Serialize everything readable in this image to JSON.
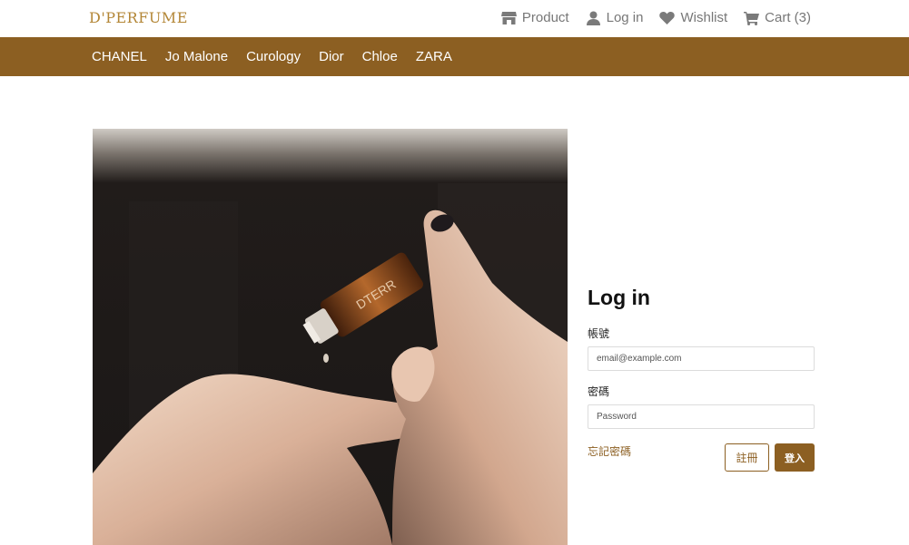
{
  "header": {
    "logo": "D'PERFUME",
    "links": [
      {
        "label": "Product",
        "icon": "store-icon"
      },
      {
        "label": "Log in",
        "icon": "user-icon"
      },
      {
        "label": "Wishlist",
        "icon": "heart-icon"
      },
      {
        "label": "Cart (3)",
        "icon": "cart-icon"
      }
    ]
  },
  "nav": {
    "brands": [
      "CHANEL",
      "Jo Malone",
      "Curology",
      "Dior",
      "Chloe",
      "ZARA"
    ]
  },
  "login": {
    "title": "Log in",
    "account_label": "帳號",
    "email_placeholder": "email@example.com",
    "password_label": "密碼",
    "password_placeholder": "Password",
    "forgot": "忘記密碼",
    "register": "註冊",
    "submit": "登入"
  },
  "hero": {
    "bottle_text": "DTERR"
  },
  "colors": {
    "accent": "#8c5f22",
    "logo": "#b38636",
    "icon": "#7a7a7a"
  }
}
